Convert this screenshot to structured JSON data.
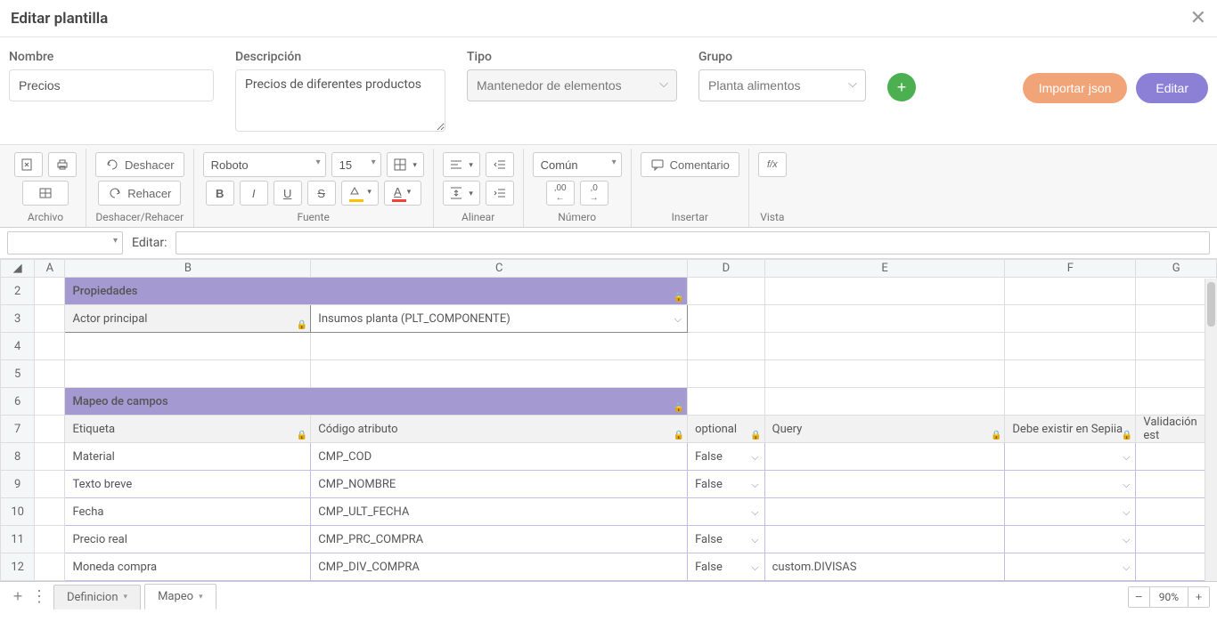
{
  "header": {
    "title": "Editar plantilla"
  },
  "form": {
    "name_label": "Nombre",
    "name_value": "Precios",
    "desc_label": "Descripción",
    "desc_value": "Precios de diferentes productos",
    "type_label": "Tipo",
    "type_value": "Mantenedor de elementos",
    "group_label": "Grupo",
    "group_value": "Planta alimentos",
    "import_btn": "Importar json",
    "edit_btn": "Editar"
  },
  "ribbon": {
    "file_label": "Archivo",
    "undo_label": "Deshacer",
    "redo_label": "Rehacer",
    "undoredo_group": "Deshacer/Rehacer",
    "font_name": "Roboto",
    "font_size": "15",
    "font_group": "Fuente",
    "align_group": "Alinear",
    "number_format": "Común",
    "number_group": "Número",
    "comment_btn": "Comentario",
    "insert_group": "Insertar",
    "view_group": "Vista"
  },
  "formula": {
    "label": "Editar:"
  },
  "columns": [
    "",
    "A",
    "B",
    "C",
    "D",
    "E",
    "F",
    "G"
  ],
  "rows": {
    "r2": {
      "b": "Propiedades"
    },
    "r3": {
      "b": "Actor principal",
      "c": "Insumos planta (PLT_COMPONENTE)"
    },
    "r6": {
      "b": "Mapeo de campos"
    },
    "r7": {
      "b": "Etiqueta",
      "c": "Código atributo",
      "d": "optional",
      "e": "Query",
      "f": "Debe existir en Sepiia",
      "g": "Validación est"
    },
    "r8": {
      "b": "Material",
      "c": "CMP_COD",
      "d": "False"
    },
    "r9": {
      "b": "Texto breve",
      "c": "CMP_NOMBRE",
      "d": "False"
    },
    "r10": {
      "b": "Fecha",
      "c": "CMP_ULT_FECHA",
      "d": ""
    },
    "r11": {
      "b": "Precio real",
      "c": "CMP_PRC_COMPRA",
      "d": "False"
    },
    "r12": {
      "b": "Moneda compra",
      "c": "CMP_DIV_COMPRA",
      "d": "False",
      "e": "custom.DIVISAS"
    }
  },
  "tabs": {
    "t1": "Definicion",
    "t2": "Mapeo"
  },
  "zoom": "90%",
  "chart_data": {
    "type": "table",
    "title": "Mapeo de campos",
    "columns": [
      "Etiqueta",
      "Código atributo",
      "optional",
      "Query",
      "Debe existir en Sepiia",
      "Validación est"
    ],
    "rows": [
      [
        "Material",
        "CMP_COD",
        "False",
        "",
        "",
        ""
      ],
      [
        "Texto breve",
        "CMP_NOMBRE",
        "False",
        "",
        "",
        ""
      ],
      [
        "Fecha",
        "CMP_ULT_FECHA",
        "",
        "",
        "",
        ""
      ],
      [
        "Precio real",
        "CMP_PRC_COMPRA",
        "False",
        "",
        "",
        ""
      ],
      [
        "Moneda compra",
        "CMP_DIV_COMPRA",
        "False",
        "custom.DIVISAS",
        "",
        ""
      ]
    ]
  }
}
